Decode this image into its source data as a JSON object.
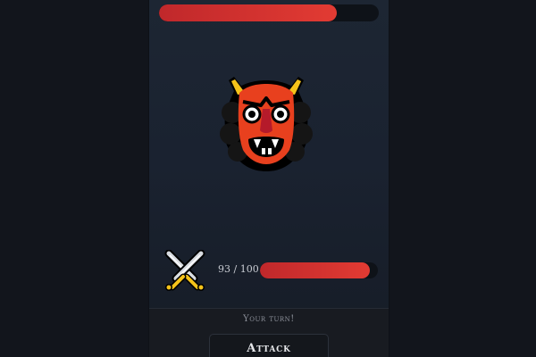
{
  "enemy": {
    "icon": "ogre-icon",
    "hp_fraction": 0.81
  },
  "player": {
    "icon": "crossed-swords-icon",
    "hp_text": "93 / 100",
    "hp_current": 93,
    "hp_max": 100
  },
  "status": {
    "turn_text": "Your turn!"
  },
  "actions": {
    "attack_label": "Attack"
  },
  "colors": {
    "background": "#12151c",
    "panel": "#1b2330",
    "hp_bar": "#d63330",
    "hp_track": "#0e1218",
    "ogre_red": "#e8401e",
    "horn_yellow": "#f5c31a"
  }
}
